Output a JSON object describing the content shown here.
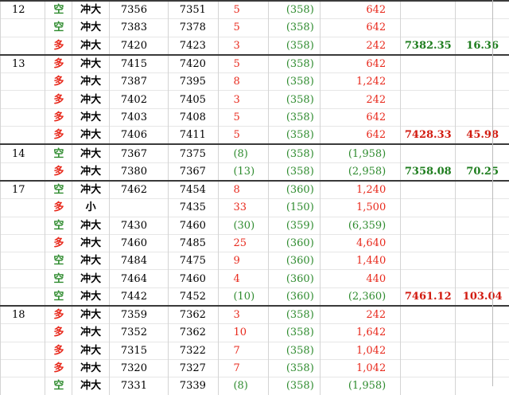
{
  "colors": {
    "long": "#e8291c",
    "short": "#2e8b2e",
    "loss": "#2e8b2e",
    "gain": "#e8291c"
  },
  "groups": [
    {
      "day": "12",
      "summary": {
        "avg": "7382.35",
        "pts": "16.36",
        "color": "green"
      },
      "rows": [
        {
          "side": "空",
          "type": "冲大",
          "entry": "7356",
          "exit": "7351",
          "points": "5",
          "points_color": "red",
          "fee": "(358)",
          "pnl": "642",
          "pnl_color": "red"
        },
        {
          "side": "空",
          "type": "冲大",
          "entry": "7383",
          "exit": "7378",
          "points": "5",
          "points_color": "red",
          "fee": "(358)",
          "pnl": "642",
          "pnl_color": "red"
        },
        {
          "side": "多",
          "type": "冲大",
          "entry": "7420",
          "exit": "7423",
          "points": "3",
          "points_color": "red",
          "fee": "(358)",
          "pnl": "242",
          "pnl_color": "red"
        }
      ]
    },
    {
      "day": "13",
      "summary": {
        "avg": "7428.33",
        "pts": "45.98",
        "color": "red"
      },
      "rows": [
        {
          "side": "多",
          "type": "冲大",
          "entry": "7415",
          "exit": "7420",
          "points": "5",
          "points_color": "red",
          "fee": "(358)",
          "pnl": "642",
          "pnl_color": "red"
        },
        {
          "side": "多",
          "type": "冲大",
          "entry": "7387",
          "exit": "7395",
          "points": "8",
          "points_color": "red",
          "fee": "(358)",
          "pnl": "1,242",
          "pnl_color": "red"
        },
        {
          "side": "多",
          "type": "冲大",
          "entry": "7402",
          "exit": "7405",
          "points": "3",
          "points_color": "red",
          "fee": "(358)",
          "pnl": "242",
          "pnl_color": "red"
        },
        {
          "side": "多",
          "type": "冲大",
          "entry": "7403",
          "exit": "7408",
          "points": "5",
          "points_color": "red",
          "fee": "(358)",
          "pnl": "642",
          "pnl_color": "red"
        },
        {
          "side": "多",
          "type": "冲大",
          "entry": "7406",
          "exit": "7411",
          "points": "5",
          "points_color": "red",
          "fee": "(358)",
          "pnl": "642",
          "pnl_color": "red"
        }
      ]
    },
    {
      "day": "14",
      "summary": {
        "avg": "7358.08",
        "pts": "70.25",
        "color": "green"
      },
      "rows": [
        {
          "side": "空",
          "type": "冲大",
          "entry": "7367",
          "exit": "7375",
          "points": "(8)",
          "points_color": "green",
          "fee": "(358)",
          "pnl": "(1,958)",
          "pnl_color": "green"
        },
        {
          "side": "多",
          "type": "冲大",
          "entry": "7380",
          "exit": "7367",
          "points": "(13)",
          "points_color": "green",
          "fee": "(358)",
          "pnl": "(2,958)",
          "pnl_color": "green"
        }
      ]
    },
    {
      "day": "17",
      "summary": {
        "avg": "7461.12",
        "pts": "103.04",
        "color": "red"
      },
      "rows": [
        {
          "side": "空",
          "type": "冲大",
          "entry": "7462",
          "exit": "7454",
          "points": "8",
          "points_color": "red",
          "fee": "(360)",
          "pnl": "1,240",
          "pnl_color": "red"
        },
        {
          "side": "多",
          "type": "小",
          "entry": "",
          "exit": "7435",
          "points": "33",
          "points_color": "red",
          "fee": "(150)",
          "pnl": "1,500",
          "pnl_color": "red"
        },
        {
          "side": "空",
          "type": "冲大",
          "entry": "7430",
          "exit": "7460",
          "points": "(30)",
          "points_color": "green",
          "fee": "(359)",
          "pnl": "(6,359)",
          "pnl_color": "green"
        },
        {
          "side": "多",
          "type": "冲大",
          "entry": "7460",
          "exit": "7485",
          "points": "25",
          "points_color": "red",
          "fee": "(360)",
          "pnl": "4,640",
          "pnl_color": "red"
        },
        {
          "side": "空",
          "type": "冲大",
          "entry": "7484",
          "exit": "7475",
          "points": "9",
          "points_color": "red",
          "fee": "(360)",
          "pnl": "1,440",
          "pnl_color": "red"
        },
        {
          "side": "空",
          "type": "冲大",
          "entry": "7464",
          "exit": "7460",
          "points": "4",
          "points_color": "red",
          "fee": "(360)",
          "pnl": "440",
          "pnl_color": "red"
        },
        {
          "side": "空",
          "type": "冲大",
          "entry": "7442",
          "exit": "7452",
          "points": "(10)",
          "points_color": "green",
          "fee": "(360)",
          "pnl": "(2,360)",
          "pnl_color": "green"
        }
      ]
    },
    {
      "day": "18",
      "summary": null,
      "rows": [
        {
          "side": "多",
          "type": "冲大",
          "entry": "7359",
          "exit": "7362",
          "points": "3",
          "points_color": "red",
          "fee": "(358)",
          "pnl": "242",
          "pnl_color": "red"
        },
        {
          "side": "多",
          "type": "冲大",
          "entry": "7352",
          "exit": "7362",
          "points": "10",
          "points_color": "red",
          "fee": "(358)",
          "pnl": "1,642",
          "pnl_color": "red"
        },
        {
          "side": "多",
          "type": "冲大",
          "entry": "7315",
          "exit": "7322",
          "points": "7",
          "points_color": "red",
          "fee": "(358)",
          "pnl": "1,042",
          "pnl_color": "red"
        },
        {
          "side": "多",
          "type": "冲大",
          "entry": "7320",
          "exit": "7327",
          "points": "7",
          "points_color": "red",
          "fee": "(358)",
          "pnl": "1,042",
          "pnl_color": "red"
        },
        {
          "side": "空",
          "type": "冲大",
          "entry": "7331",
          "exit": "7339",
          "points": "(8)",
          "points_color": "green",
          "fee": "(358)",
          "pnl": "(1,958)",
          "pnl_color": "green"
        }
      ]
    }
  ]
}
